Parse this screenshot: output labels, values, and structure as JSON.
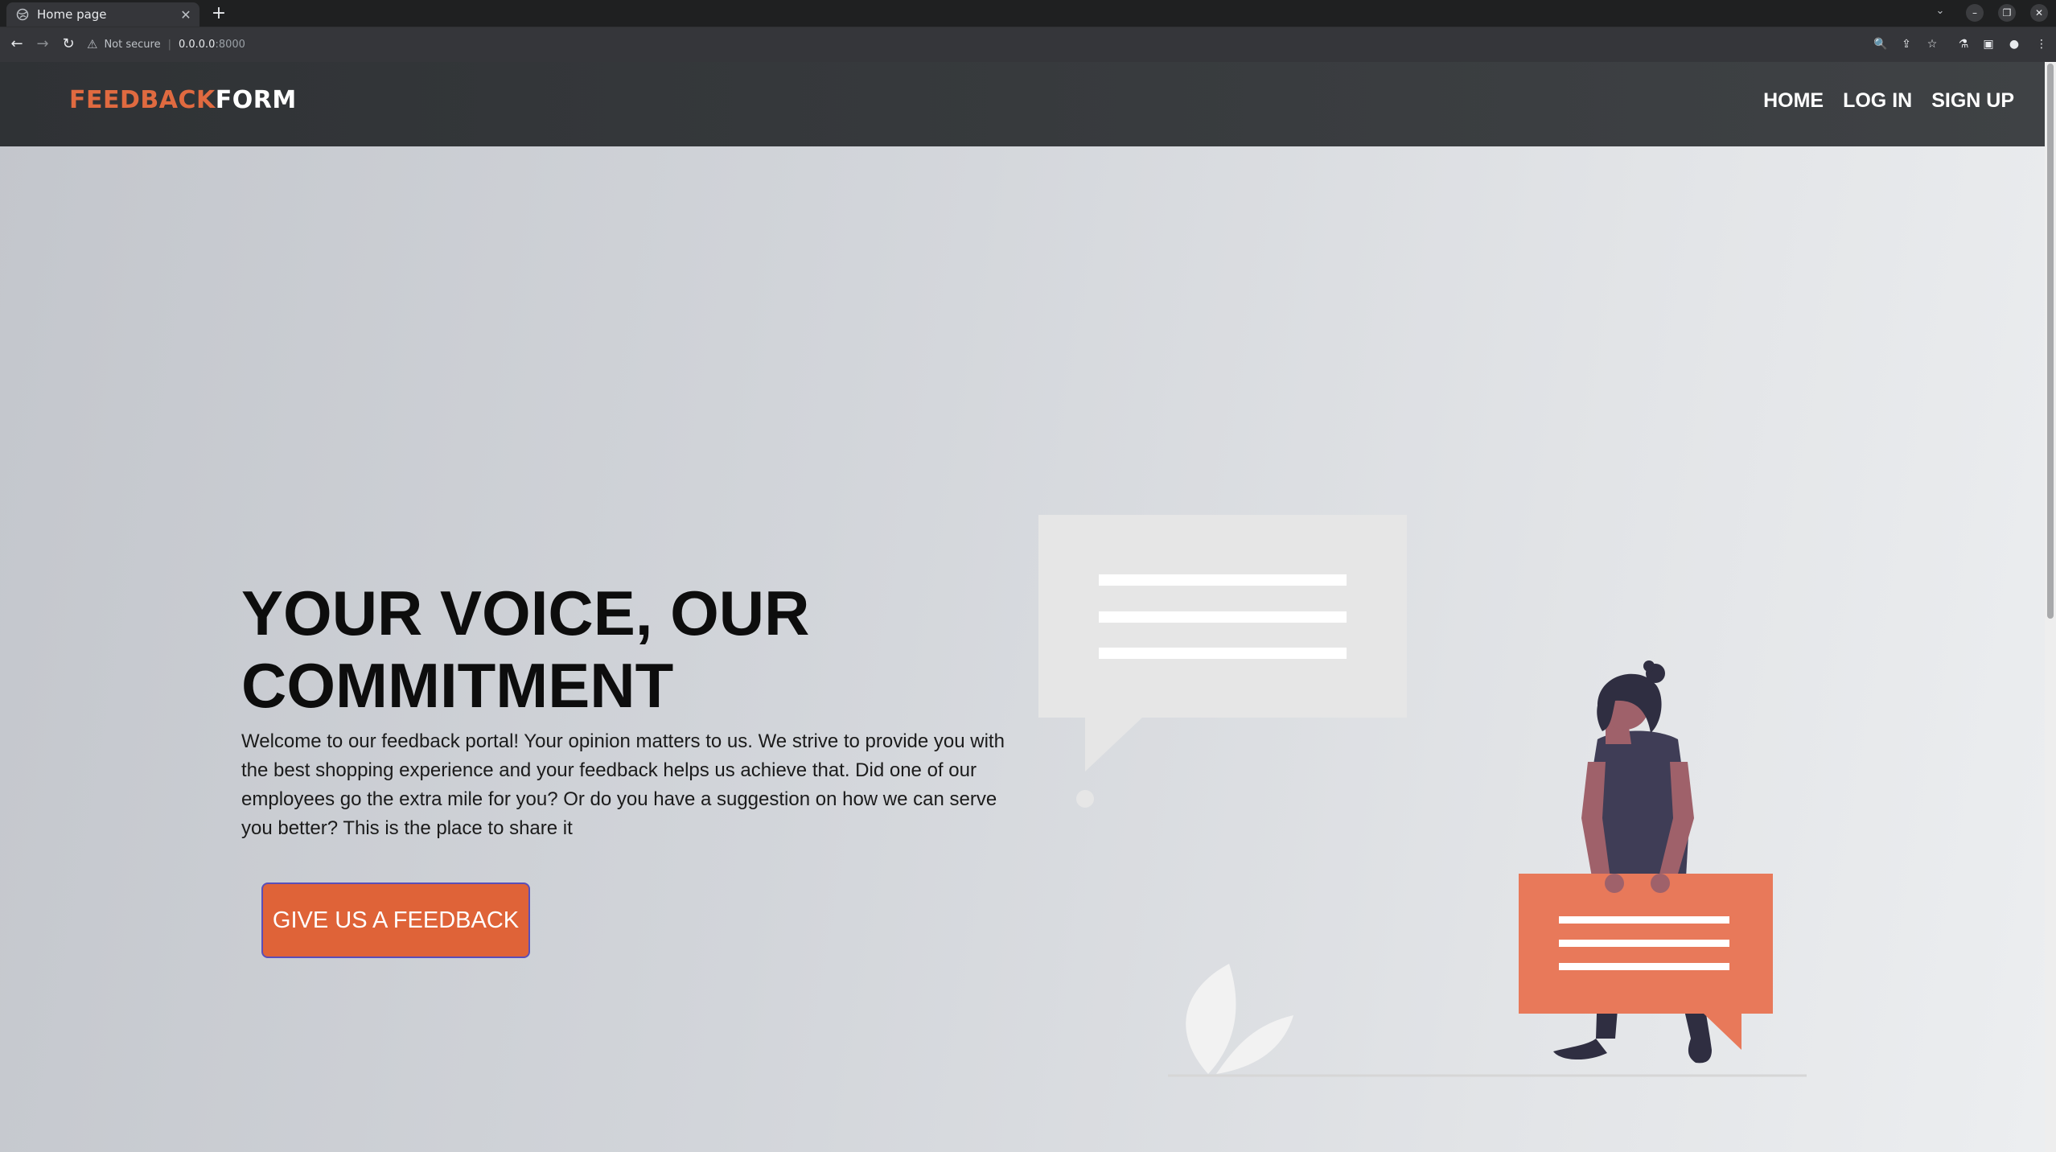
{
  "browser": {
    "tab_title": "Home page",
    "new_tab_symbol": "+",
    "security_label": "Not secure",
    "url_host": "0.0.0.0",
    "url_port": ":8000"
  },
  "site": {
    "brand_part1": "FEEDBACK",
    "brand_part2": "FORM",
    "nav": {
      "home": "HOME",
      "login": "LOG IN",
      "signup": "SIGN UP"
    }
  },
  "hero": {
    "title": "YOUR VOICE, OUR COMMITMENT",
    "text": "Welcome to our feedback portal! Your opinion matters to us. We strive to provide you with the best shopping experience and your feedback helps us achieve that. Did one of our employees go the extra mile for you? Or do you have a suggestion on how we can serve you better? This is the place to share it",
    "cta_label": "GIVE US A FEEDBACK"
  },
  "colors": {
    "accent": "#df6338",
    "brand_accent": "#e06a40",
    "navbar": "#3a3d40",
    "illustration_orange": "#e8795a"
  },
  "icons": [
    "globe-icon",
    "tab-close-icon",
    "new-tab-icon",
    "back-icon",
    "forward-icon",
    "reload-icon",
    "warning-icon",
    "zoom-icon",
    "share-icon",
    "star-icon",
    "extension-icon",
    "sidebar-icon",
    "profile-icon",
    "menu-icon"
  ]
}
